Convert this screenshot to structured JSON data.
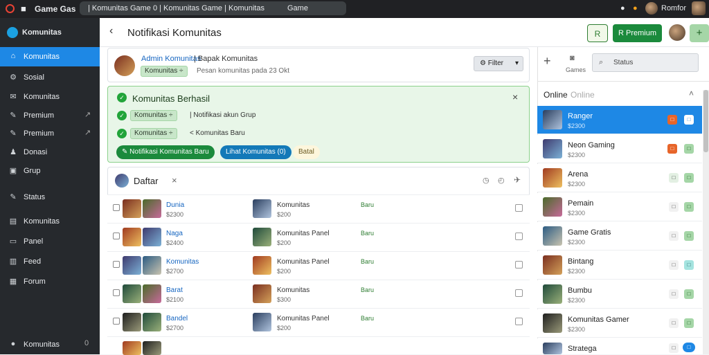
{
  "topbar": {
    "logo": "■",
    "app_title": "Game Gas",
    "tab_text": "| Komunitas Game 0 | Komunitas Game | Komunitas",
    "tab_suffix": "Game",
    "user_name": "Romfor"
  },
  "sidebar": {
    "header": "Komunitas",
    "items": [
      {
        "label": "Komunitas",
        "icon": "home-icon",
        "glyph": "⌂",
        "active": true
      },
      {
        "label": "Sosial",
        "icon": "gear-icon",
        "glyph": "⚙"
      },
      {
        "label": "Komunitas",
        "icon": "chat-icon",
        "glyph": "✉"
      },
      {
        "label": "Premium",
        "icon": "edit-icon",
        "glyph": "✎",
        "arrow": "↗"
      },
      {
        "label": "Premium",
        "icon": "edit-icon",
        "glyph": "✎",
        "arrow": "↗"
      },
      {
        "label": "Donasi",
        "icon": "user-icon",
        "glyph": "♟"
      },
      {
        "label": "Grup",
        "icon": "box-icon",
        "glyph": "▣"
      },
      {
        "label": "Status",
        "icon": "tool-icon",
        "glyph": "✎"
      },
      {
        "label": "Komunitas",
        "icon": "calendar-icon",
        "glyph": "▤"
      },
      {
        "label": "Panel",
        "icon": "panel-icon",
        "glyph": "▭"
      },
      {
        "label": "Feed",
        "icon": "feed-icon",
        "glyph": "▥"
      },
      {
        "label": "Forum",
        "icon": "grid-icon",
        "glyph": "▦"
      }
    ],
    "footer": {
      "label": "Komunitas",
      "icon": "info-icon",
      "glyph": "●",
      "count": "0"
    }
  },
  "header": {
    "title": "Notifikasi Komunitas",
    "outline_btn": "R",
    "green_btn": "R Premium",
    "plus_btn": "+"
  },
  "profile": {
    "name": "Admin Komunitas",
    "extra": "| Bapak Komunitas",
    "tag": "Komunitas ÷",
    "meta": "Pesan komunitas pada 23 Okt",
    "filter_label": "Filter"
  },
  "success": {
    "title": "Komunitas Berhasil",
    "line1_pill": "Komunitas ÷",
    "line1_text": "| Notifikasi akun Grup",
    "line2_pill": "Komunitas ÷",
    "line2_text": "< Komunitas Baru",
    "btn1": "Notifikasi Komunitas Baru",
    "btn2": "Lihat Komunitas (0)",
    "btn3": "Batal"
  },
  "list": {
    "title": "Daftar",
    "rows": [
      {
        "name": "Dunia",
        "sub": "$2300",
        "n2": "Komunitas",
        "s2": "$200",
        "status": "Baru"
      },
      {
        "name": "Naga",
        "sub": "$2400",
        "n2": "Komunitas Panel",
        "s2": "$200",
        "status": "Baru"
      },
      {
        "name": "Komunitas",
        "sub": "$2700",
        "n2": "Komunitas Panel",
        "s2": "$200",
        "status": "Baru"
      },
      {
        "name": "Barat",
        "sub": "$2100",
        "n2": "Komunitas",
        "s2": "$300",
        "status": "Baru"
      },
      {
        "name": "Bandel",
        "sub": "$2700",
        "n2": "Komunitas Panel",
        "s2": "$200",
        "status": "Baru"
      }
    ]
  },
  "right": {
    "search_placeholder": "Status",
    "games_label": "Games",
    "tab_online": "Online",
    "tab_online2": "Online",
    "players": [
      {
        "name": "Ranger",
        "sub": "$2300",
        "selected": true
      },
      {
        "name": "Neon Gaming",
        "sub": "$2300"
      },
      {
        "name": "Arena",
        "sub": "$2300"
      },
      {
        "name": "Pemain",
        "sub": "$2300"
      },
      {
        "name": "Game Gratis",
        "sub": "$2300"
      },
      {
        "name": "Bintang",
        "sub": "$2300"
      },
      {
        "name": "Bumbu",
        "sub": "$2300"
      },
      {
        "name": "Komunitas Gamer",
        "sub": "$2300"
      },
      {
        "name": "Stratega",
        "sub": ""
      }
    ]
  }
}
